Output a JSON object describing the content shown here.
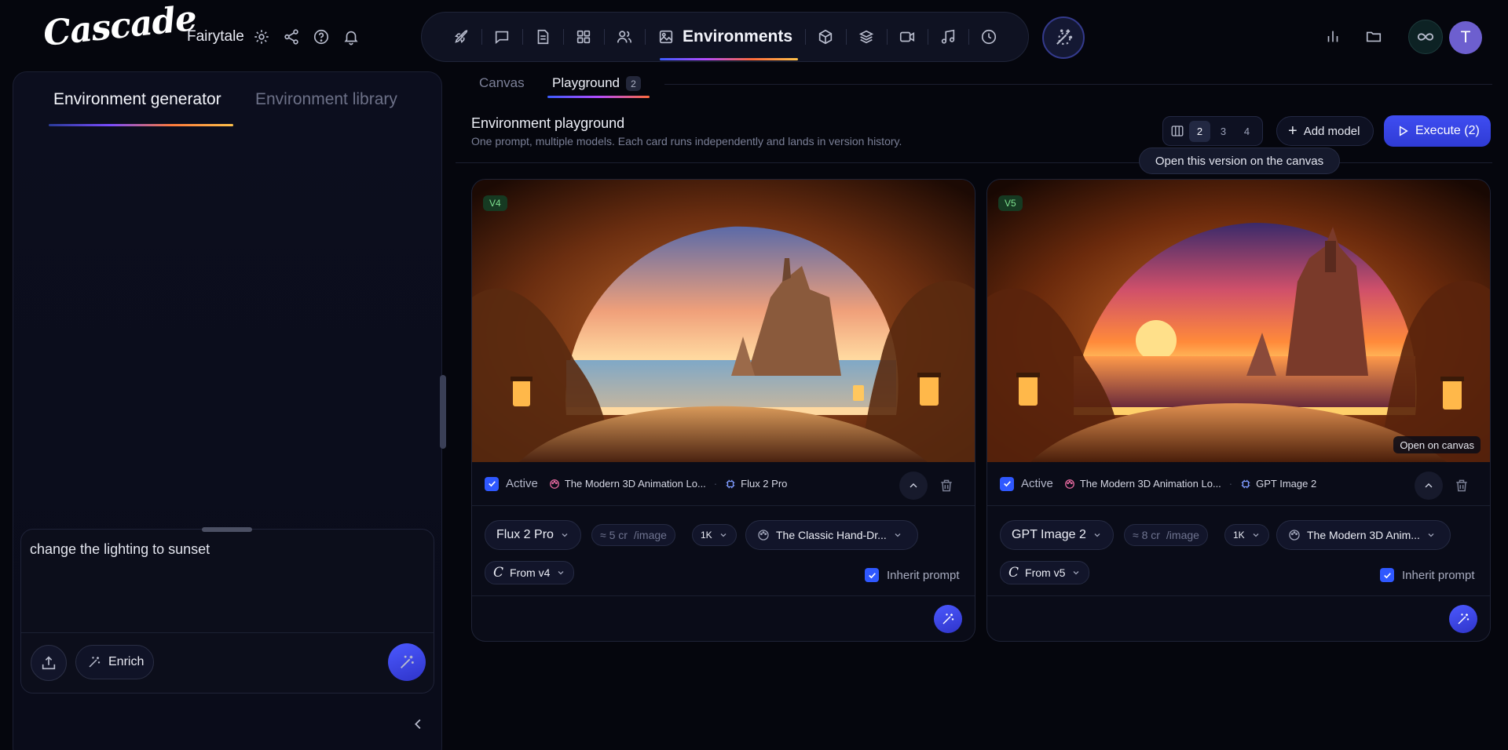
{
  "app": {
    "logo": "Cascade",
    "project": "Fairytale"
  },
  "topnav": {
    "active_label": "Environments"
  },
  "user": {
    "initial": "T"
  },
  "left": {
    "tabs": [
      "Environment generator",
      "Environment library"
    ],
    "prompt": "change the lighting to sunset",
    "enrich_label": "Enrich"
  },
  "main": {
    "subtabs": {
      "canvas": "Canvas",
      "playground": "Playground",
      "playground_count": "2"
    },
    "title": "Environment playground",
    "subtitle": "One prompt, multiple models. Each card runs independently and lands in version history.",
    "columns": [
      "2",
      "3",
      "4"
    ],
    "selected_columns": "2",
    "add_model": "Add model",
    "execute": "Execute (2)",
    "tooltip": "Open this version on the canvas"
  },
  "cards": [
    {
      "version": "V4",
      "active_label": "Active",
      "style_short": "The Modern 3D Animation Lo...",
      "model_short": "Flux 2 Pro",
      "model": "Flux 2 Pro",
      "cost_value": "≈ 5 cr",
      "cost_unit": "/image",
      "resolution": "1K",
      "style": "The Classic Hand-Dr...",
      "from": "From v4",
      "inherit_label": "Inherit prompt"
    },
    {
      "version": "V5",
      "active_label": "Active",
      "style_short": "The Modern 3D Animation Lo...",
      "model_short": "GPT Image 2",
      "model": "GPT Image 2",
      "cost_value": "≈ 8 cr",
      "cost_unit": "/image",
      "resolution": "1K",
      "style": "The Modern 3D Anim...",
      "from": "From v5",
      "inherit_label": "Inherit prompt",
      "open_canvas": "Open on canvas"
    }
  ],
  "icons": {
    "project": [
      "gear-icon",
      "share-icon",
      "help-icon",
      "bell-icon"
    ],
    "nav": [
      "rocket-icon",
      "chat-icon",
      "document-icon",
      "grid-icon",
      "users-icon",
      "image-icon",
      "cube-icon",
      "layers-icon",
      "video-icon",
      "music-icon",
      "clock-icon"
    ],
    "right": [
      "chart-icon",
      "folder-icon",
      "infinity-icon"
    ]
  },
  "colors": {
    "accent": "#3f4df2",
    "active_check": "#2f58ff",
    "version_badge": "#7ee08f"
  }
}
